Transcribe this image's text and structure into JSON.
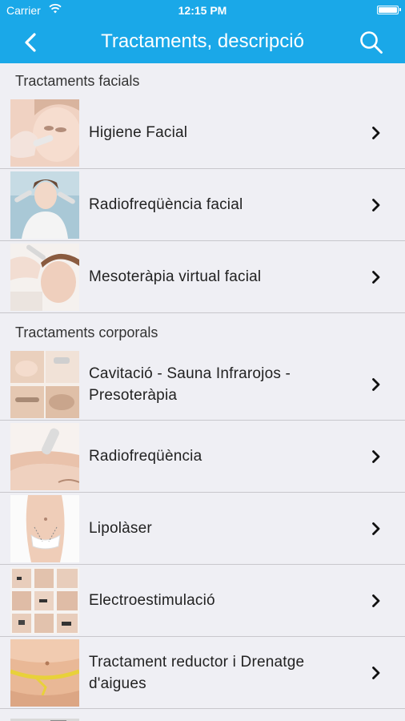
{
  "statusbar": {
    "carrier": "Carrier",
    "time": "12:15 PM"
  },
  "navbar": {
    "title": "Tractaments, descripció"
  },
  "sections": [
    {
      "title": "Tractaments facials",
      "items": [
        {
          "label": "Higiene Facial"
        },
        {
          "label": "Radiofreqüència facial"
        },
        {
          "label": "Mesoteràpia virtual facial"
        }
      ]
    },
    {
      "title": "Tractaments corporals",
      "items": [
        {
          "label": "Cavitació - Sauna Infrarojos - Presoteràpia"
        },
        {
          "label": "Radiofreqüència"
        },
        {
          "label": "Lipolàser"
        },
        {
          "label": "Electroestimulació"
        },
        {
          "label": "Tractament reductor i Drenatge d'aigues"
        }
      ]
    }
  ],
  "colors": {
    "accent": "#1aa8e8",
    "background": "#efeff4",
    "separator": "#c8c7cc"
  }
}
